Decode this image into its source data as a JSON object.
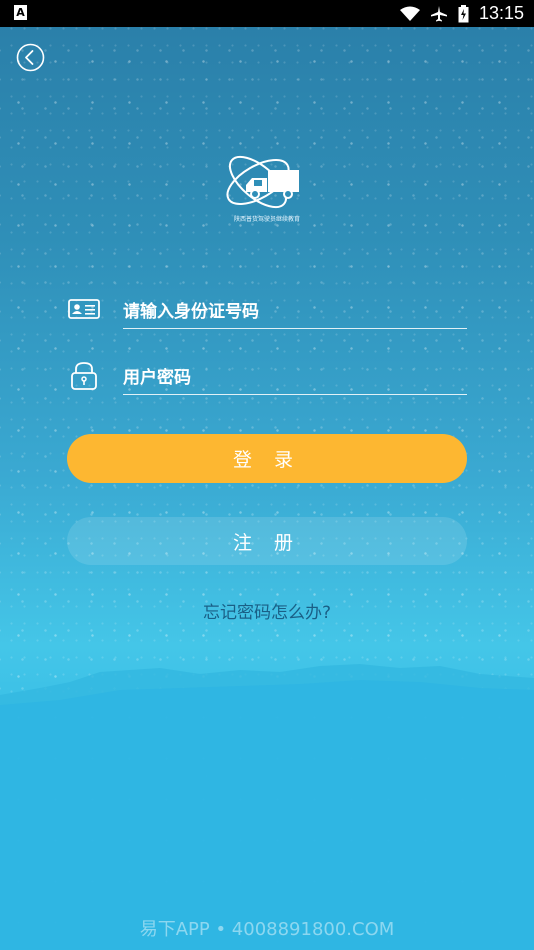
{
  "status_bar": {
    "notification_glyph": "A",
    "time": "13:15",
    "icons": [
      "wifi-icon",
      "airplane-icon",
      "battery-icon"
    ]
  },
  "header": {
    "back_icon": "chevron-left-icon"
  },
  "logo": {
    "tagline": "陕西普货驾驶员继续教育"
  },
  "form": {
    "id_placeholder": "请输入身份证号码",
    "password_placeholder": "用户密码",
    "login_label": "登 录",
    "register_label": "注 册",
    "forgot_label": "忘记密码怎么办?"
  },
  "watermark": "易下APP • 4008891800.COM",
  "colors": {
    "login_button": "#fdb731",
    "forgot_link": "#1a5f86",
    "background_top": "#2a7ea8",
    "background_bottom": "#2bb5e3"
  }
}
